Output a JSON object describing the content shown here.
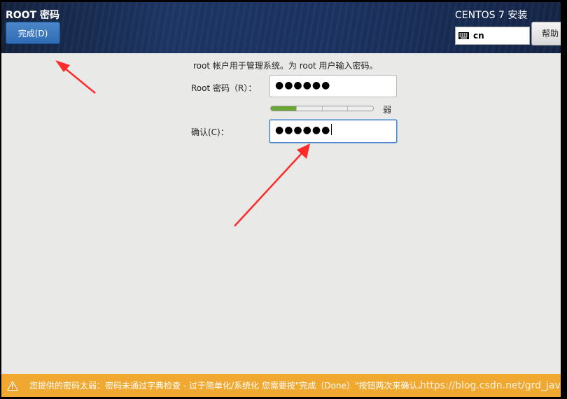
{
  "header": {
    "spoke_title": "ROOT 密码",
    "done_label": "完成(D)",
    "product_title": "CENTOS 7 安装",
    "keyboard_layout": "cn",
    "help_label": "帮助"
  },
  "form": {
    "intro": "root 帐户用于管理系统。为 root 用户输入密码。",
    "root_password_label": "Root 密码（R）：",
    "root_password_value": "●●●●●●",
    "strength": {
      "level": 1,
      "max": 4,
      "label": "弱"
    },
    "confirm_label": "确认(C)：",
    "confirm_value": "●●●●●●"
  },
  "warning": {
    "message": "您提供的密码太弱：密码未通过字典检查 - 过于简单化/系统化 您需要按\"完成（Done）\"按钮两次来确认。"
  },
  "watermark": "https://blog.csdn.net/grd_java",
  "colors": {
    "header_bg": "#1c3563",
    "accent": "#4a86c8",
    "warning_bg": "#f0a830",
    "strength_fill": "#6aa833",
    "annotation_arrow": "#ff2a2a"
  }
}
